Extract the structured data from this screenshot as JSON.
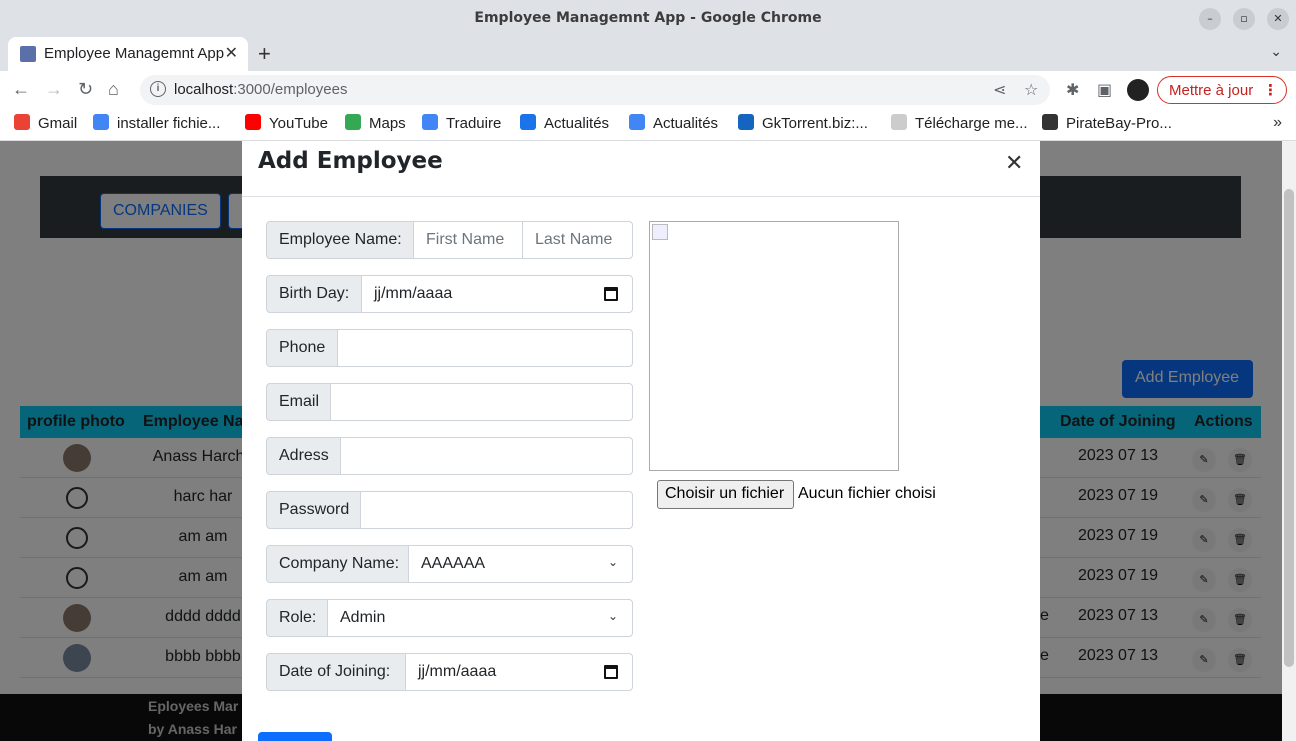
{
  "window": {
    "title": "Employee Managemnt App - Google Chrome",
    "tab_title": "Employee Managemnt App",
    "url_host": "localhost",
    "url_path": ":3000/employees",
    "update_label": "Mettre à jour"
  },
  "bookmarks": [
    "Gmail",
    "installer fichie...",
    "YouTube",
    "Maps",
    "Traduire",
    "Actualités",
    "Actualités",
    "GkTorrent.biz:...",
    "Télécharge me...",
    "PirateBay-Pro..."
  ],
  "page": {
    "nav_companies": "COMPANIES",
    "add_employee": "Add Employee",
    "columns": [
      "profile photo",
      "Employee Na",
      "Date of Joining",
      "Actions"
    ],
    "rows": [
      {
        "name": "Anass Harcha",
        "date": "2023 07 13",
        "extra": ""
      },
      {
        "name": "harc har",
        "date": "2023 07 19",
        "extra": ""
      },
      {
        "name": "am am",
        "date": "2023 07 19",
        "extra": ""
      },
      {
        "name": "am am",
        "date": "2023 07 19",
        "extra": ""
      },
      {
        "name": "dddd dddd",
        "date": "2023 07 13",
        "extra": "e"
      },
      {
        "name": "bbbb bbbb",
        "date": "2023 07 13",
        "extra": "e"
      }
    ],
    "footer_line1": "Eployees Mar",
    "footer_line2": "by Anass Har"
  },
  "modal": {
    "title": "Add Employee",
    "fields": {
      "employee_name_label": "Employee Name:",
      "first_name_placeholder": "First Name",
      "last_name_placeholder": "Last Name",
      "birth_day_label": "Birth Day:",
      "birth_day_value": "jj/mm/aaaa",
      "phone_label": "Phone",
      "email_label": "Email",
      "adress_label": "Adress",
      "password_label": "Password",
      "company_label": "Company Name:",
      "company_value": "AAAAAA",
      "role_label": "Role:",
      "role_value": "Admin",
      "joining_label": "Date of Joining:",
      "joining_value": "jj/mm/aaaa"
    },
    "file_button": "Choisir un fichier",
    "file_status": "Aucun fichier choisi"
  }
}
